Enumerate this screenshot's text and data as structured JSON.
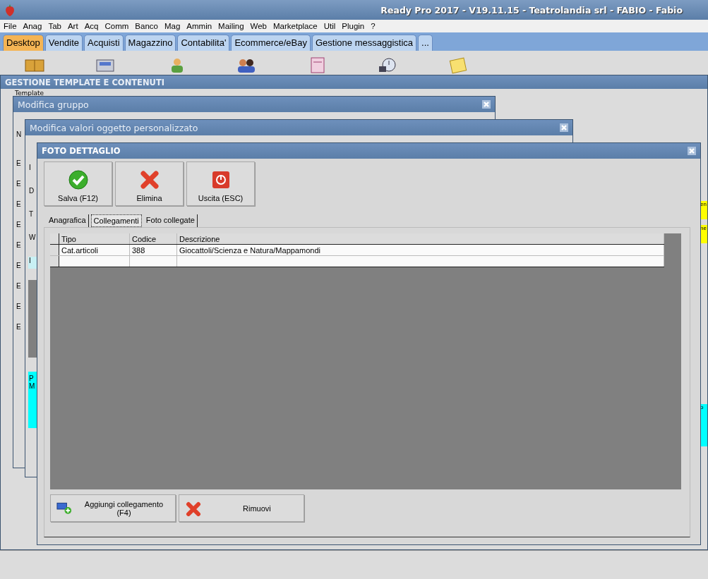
{
  "app": {
    "title": "Ready Pro 2017 - V19.11.15 - Teatrolandia srl - FABIO - Fabio"
  },
  "menu": [
    "File",
    "Anag",
    "Tab",
    "Art",
    "Acq",
    "Comm",
    "Banco",
    "Mag",
    "Ammin",
    "Mailing",
    "Web",
    "Marketplace",
    "Util",
    "Plugin",
    "?"
  ],
  "tabs": [
    {
      "label": "Desktop",
      "selected": true
    },
    {
      "label": "Vendite",
      "selected": false
    },
    {
      "label": "Acquisti",
      "selected": false
    },
    {
      "label": "Magazzino",
      "selected": false
    },
    {
      "label": "Contabilita'",
      "selected": false
    },
    {
      "label": "Ecommerce/eBay",
      "selected": false
    },
    {
      "label": "Gestione messaggistica",
      "selected": false
    },
    {
      "label": "...",
      "selected": false
    }
  ],
  "toolbar": [
    {
      "kind": "box"
    },
    {
      "kind": "register"
    },
    {
      "kind": "person"
    },
    {
      "kind": "people"
    },
    {
      "kind": "document"
    },
    {
      "kind": "clock"
    },
    {
      "kind": "note"
    }
  ],
  "main_window": {
    "title": "GESTIONE TEMPLATE E CONTENUTI",
    "label": "Template",
    "right_cells": [
      {
        "text": "en",
        "color": "#ffff00"
      },
      {
        "text": "ne",
        "color": "#ffff00"
      },
      {
        "text": "o",
        "color": "#00ffff"
      }
    ]
  },
  "group_window": {
    "title": "Modifica gruppo",
    "field_label": "N",
    "rows": [
      "E",
      "E",
      "E",
      "E",
      "E",
      "E",
      "E",
      "E",
      "E"
    ]
  },
  "values_window": {
    "title": "Modifica valori oggetto personalizzato",
    "rows": [
      {
        "text": "I",
        "color": "#dcdcdc"
      },
      {
        "text": "D",
        "color": "#dcdcdc"
      },
      {
        "text": "T",
        "color": "#dcdcdc"
      },
      {
        "text": "W",
        "color": "#dcdcdc"
      },
      {
        "text": "I",
        "color": "#c8f0f4"
      }
    ],
    "note": [
      "P",
      "M"
    ]
  },
  "dialog": {
    "title": "FOTO DETTAGLIO",
    "buttons": [
      {
        "label": "Salva (F12)",
        "kind": "save"
      },
      {
        "label": "Elimina",
        "kind": "delete"
      },
      {
        "label": "Uscita (ESC)",
        "kind": "exit"
      }
    ],
    "tabs": [
      {
        "label": "Anagrafica",
        "selected": false
      },
      {
        "label": "Collegamenti",
        "selected": true
      },
      {
        "label": "Foto collegate",
        "selected": false
      }
    ],
    "table": {
      "columns": [
        "Tipo",
        "Codice",
        "Descrizione"
      ],
      "rows": [
        [
          "Cat.articoli",
          "388",
          "Giocattoli/Scienza e Natura/Mappamondi"
        ],
        [
          "",
          "",
          ""
        ]
      ]
    },
    "actions": [
      {
        "label": "Aggiungi collegamento (F4)",
        "kind": "add"
      },
      {
        "label": "Rimuovi",
        "kind": "remove"
      }
    ]
  }
}
